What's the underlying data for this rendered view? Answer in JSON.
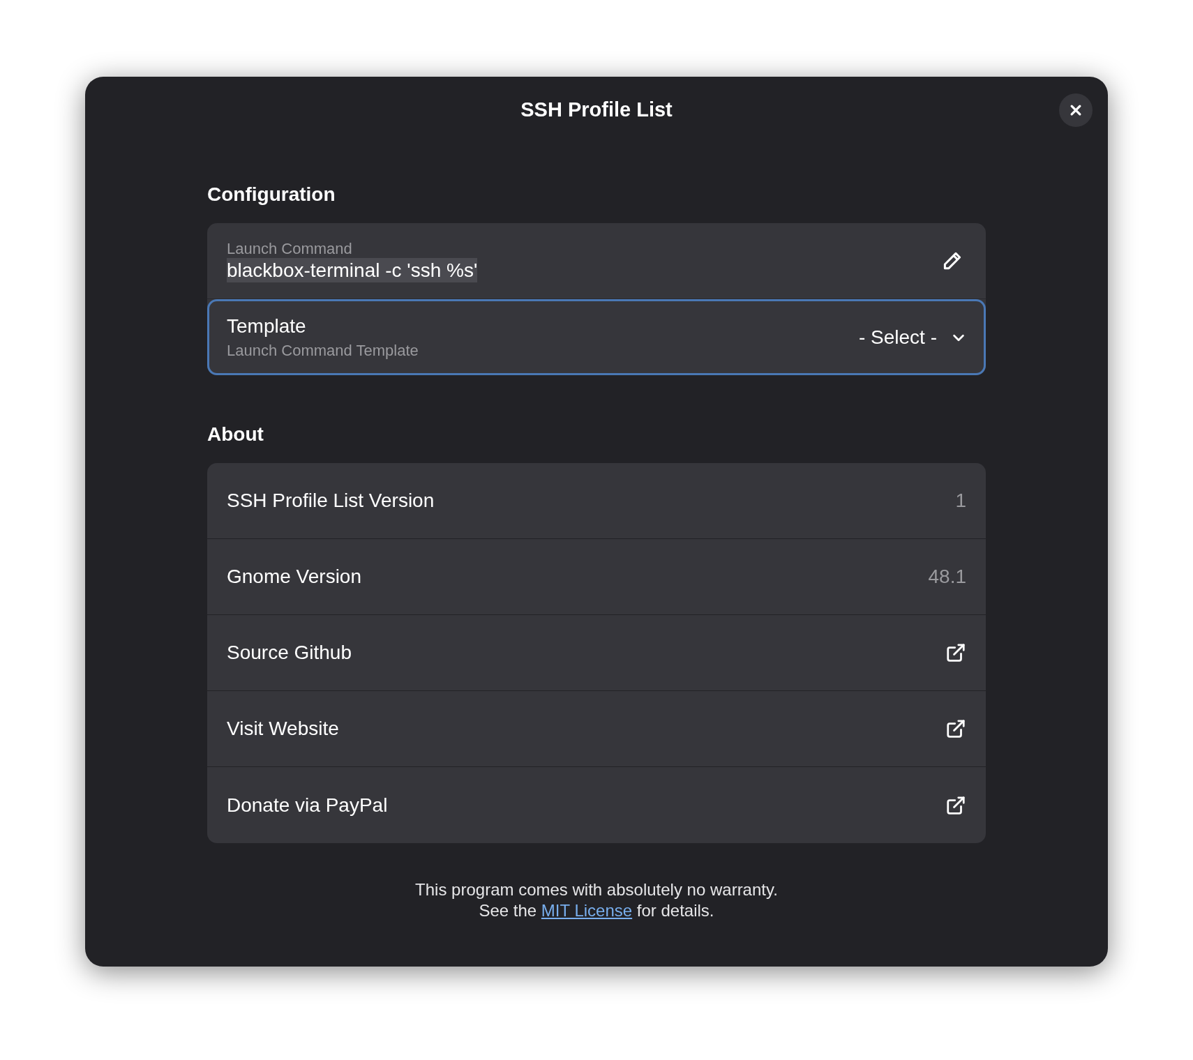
{
  "dialog": {
    "title": "SSH Profile List"
  },
  "configuration": {
    "heading": "Configuration",
    "rows": [
      {
        "kind": "entry",
        "label": "Launch Command",
        "value": "blackbox-terminal -c 'ssh %s'",
        "text_selected": true,
        "focused": false
      },
      {
        "kind": "combo",
        "title": "Template",
        "subtitle": "Launch Command Template",
        "value": "- Select -",
        "focused": true
      }
    ]
  },
  "about": {
    "heading": "About",
    "rows": [
      {
        "kind": "value",
        "title": "SSH Profile List Version",
        "value": "1"
      },
      {
        "kind": "value",
        "title": "Gnome Version",
        "value": "48.1"
      },
      {
        "kind": "link",
        "title": "Source Github"
      },
      {
        "kind": "link",
        "title": "Visit Website"
      },
      {
        "kind": "link",
        "title": "Donate via PayPal"
      }
    ]
  },
  "footer": {
    "line_1": "This program comes with absolutely no warranty.",
    "line_2_before": "See the",
    "link": "MIT License",
    "line_2_after": "for details."
  }
}
